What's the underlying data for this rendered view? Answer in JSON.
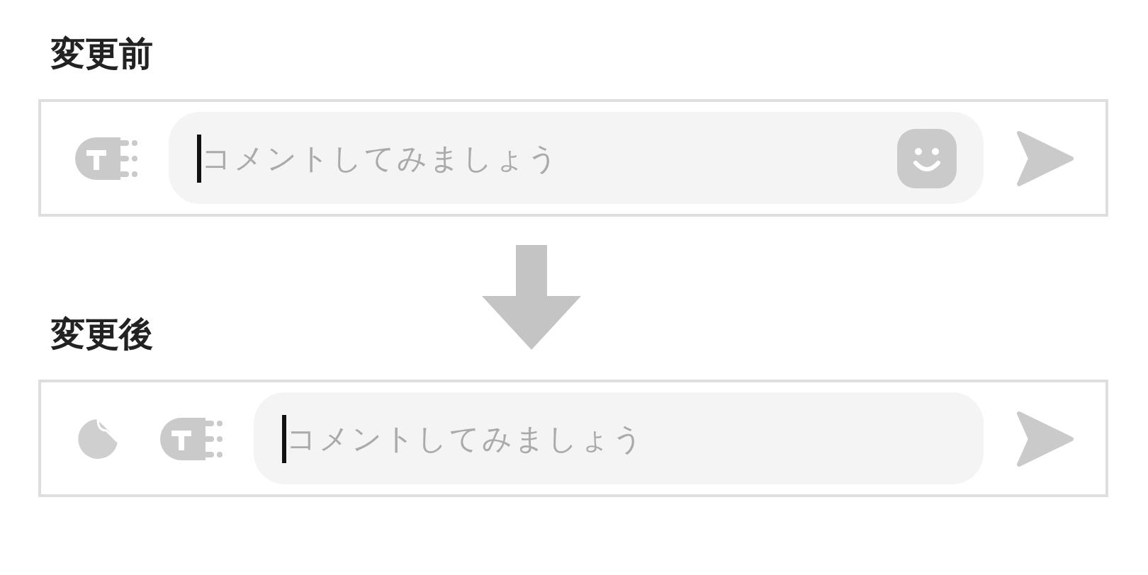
{
  "sections": [
    {
      "heading": "変更前",
      "composer": {
        "tools": [
          {
            "kind": "text-effect"
          }
        ],
        "placeholder": "コメントしてみましょう",
        "emoji_button": true
      }
    },
    {
      "heading": "変更後",
      "composer": {
        "tools": [
          {
            "kind": "sticker"
          },
          {
            "kind": "text-effect"
          }
        ],
        "placeholder": "コメントしてみましょう",
        "emoji_button": false
      }
    }
  ]
}
